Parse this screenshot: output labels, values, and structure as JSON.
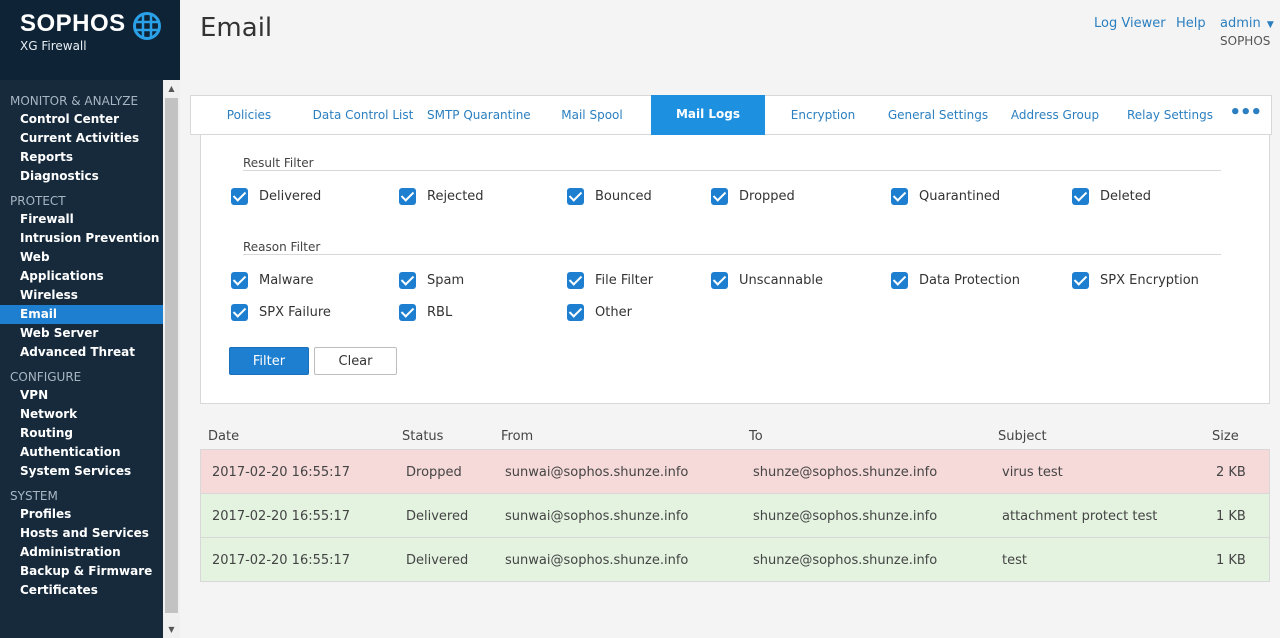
{
  "brand": {
    "name": "SOPHOS",
    "product": "XG Firewall",
    "logo_icon": "globe-icon"
  },
  "nav": [
    {
      "section": "MONITOR & ANALYZE",
      "items": [
        "Control Center",
        "Current Activities",
        "Reports",
        "Diagnostics"
      ]
    },
    {
      "section": "PROTECT",
      "items": [
        "Firewall",
        "Intrusion Prevention",
        "Web",
        "Applications",
        "Wireless",
        "Email",
        "Web Server",
        "Advanced Threat"
      ]
    },
    {
      "section": "CONFIGURE",
      "items": [
        "VPN",
        "Network",
        "Routing",
        "Authentication",
        "System Services"
      ]
    },
    {
      "section": "SYSTEM",
      "items": [
        "Profiles",
        "Hosts and Services",
        "Administration",
        "Backup & Firmware",
        "Certificates"
      ]
    }
  ],
  "nav_active": "Email",
  "page": {
    "title": "Email"
  },
  "top": {
    "log_viewer": "Log Viewer",
    "help": "Help",
    "user": "admin",
    "org": "SOPHOS"
  },
  "tabs": [
    "Policies",
    "Data Control List",
    "SMTP Quarantine",
    "Mail Spool",
    "Mail Logs",
    "Encryption",
    "General Settings",
    "Address Group",
    "Relay Settings"
  ],
  "tab_active": "Mail Logs",
  "tab_more": "•••",
  "filters": {
    "result_title": "Result Filter",
    "result": [
      "Delivered",
      "Rejected",
      "Bounced",
      "Dropped",
      "Quarantined",
      "Deleted"
    ],
    "reason_title": "Reason Filter",
    "reason": [
      "Malware",
      "Spam",
      "File Filter",
      "Unscannable",
      "Data Protection",
      "SPX Encryption",
      "SPX Failure",
      "RBL",
      "Other"
    ],
    "filter_button": "Filter",
    "clear_button": "Clear"
  },
  "table": {
    "columns": [
      "Date",
      "Status",
      "From",
      "To",
      "Subject",
      "Size"
    ],
    "rows": [
      {
        "date": "2017-02-20 16:55:17",
        "status": "Dropped",
        "from": "sunwai@sophos.shunze.info",
        "to": "shunze@sophos.shunze.info",
        "subject": "virus test",
        "size": "2 KB",
        "color": "#f6d9d9"
      },
      {
        "date": "2017-02-20 16:55:17",
        "status": "Delivered",
        "from": "sunwai@sophos.shunze.info",
        "to": "shunze@sophos.shunze.info",
        "subject": "attachment protect test",
        "size": "1 KB",
        "color": "#e3f3e0"
      },
      {
        "date": "2017-02-20 16:55:17",
        "status": "Delivered",
        "from": "sunwai@sophos.shunze.info",
        "to": "shunze@sophos.shunze.info",
        "subject": "test",
        "size": "1 KB",
        "color": "#e3f3e0"
      }
    ]
  },
  "colors": {
    "accent": "#1e7fd0",
    "sidebar": "#162a3c",
    "dropped_row": "#f6d9d9",
    "delivered_row": "#e3f3e0"
  }
}
